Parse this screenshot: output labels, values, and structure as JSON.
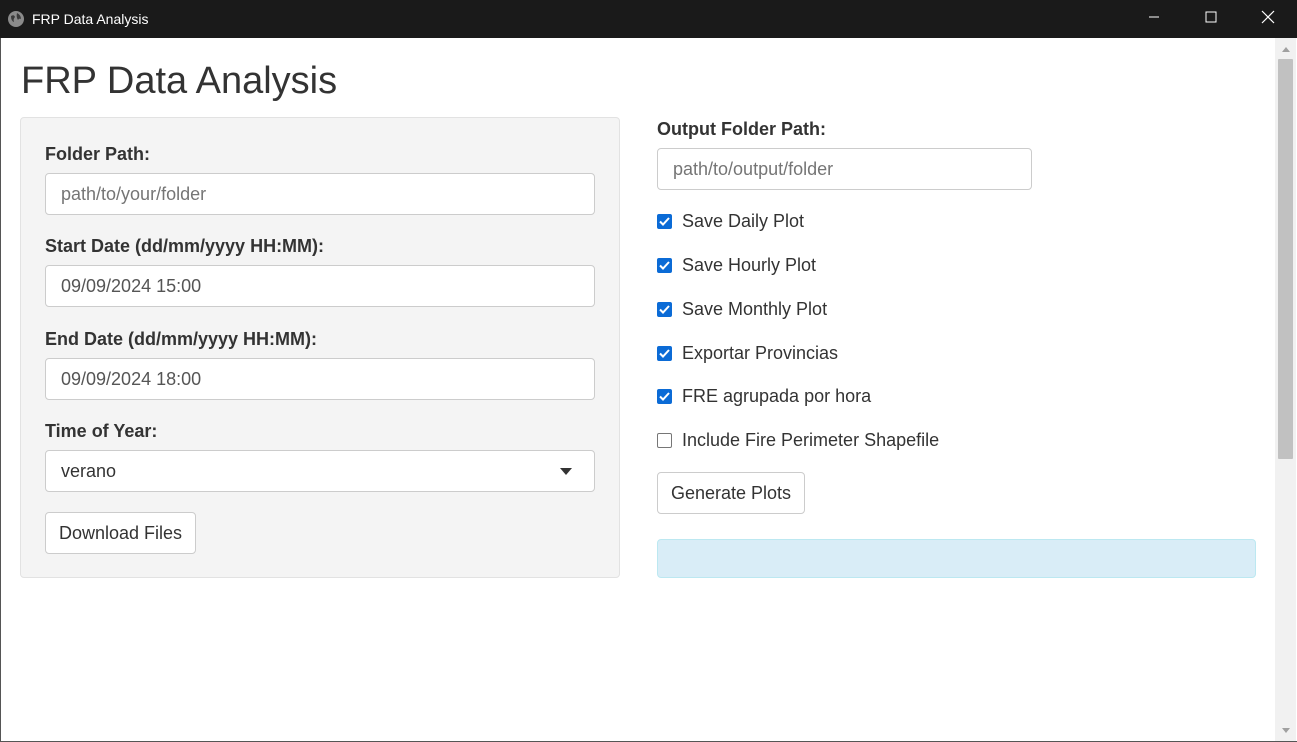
{
  "window": {
    "title": "FRP Data Analysis",
    "app_icon": "globe-icon",
    "controls": [
      "minimize-icon",
      "maximize-icon",
      "close-icon"
    ]
  },
  "page": {
    "title": "FRP Data Analysis"
  },
  "left_panel": {
    "folder_path_label": "Folder Path:",
    "folder_path_value": "path/to/your/folder",
    "start_date_label": "Start Date (dd/mm/yyyy HH:MM):",
    "start_date_value": "09/09/2024 15:00",
    "end_date_label": "End Date (dd/mm/yyyy HH:MM):",
    "end_date_value": "09/09/2024 18:00",
    "time_of_year_label": "Time of Year:",
    "time_of_year_value": "verano",
    "download_button": "Download Files"
  },
  "right_panel": {
    "output_folder_label": "Output Folder Path:",
    "output_folder_value": "path/to/output/folder",
    "checkboxes": [
      {
        "label": "Save Daily Plot",
        "checked": true
      },
      {
        "label": "Save Hourly Plot",
        "checked": true
      },
      {
        "label": "Save Monthly Plot",
        "checked": true
      },
      {
        "label": "Exportar Provincias",
        "checked": true
      },
      {
        "label": "FRE agrupada por hora",
        "checked": true
      },
      {
        "label": "Include Fire Perimeter Shapefile",
        "checked": false
      }
    ],
    "generate_button": "Generate Plots"
  },
  "colors": {
    "titlebar": "#1a1a1a",
    "checkbox_accent": "#0b6bd6",
    "info_box": "#d9edf7",
    "panel_bg": "#f4f4f4"
  }
}
